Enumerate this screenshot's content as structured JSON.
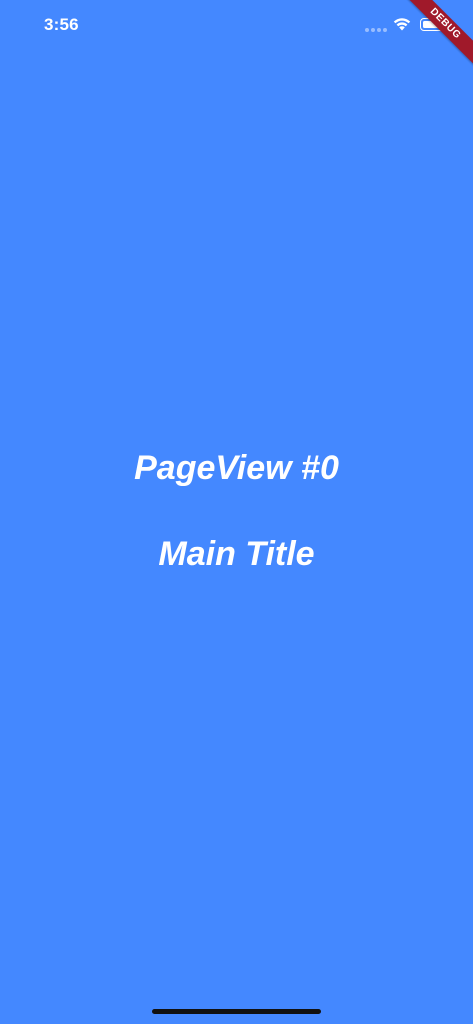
{
  "status_bar": {
    "time": "3:56",
    "wifi_icon": "wifi-icon",
    "battery_icon": "battery-icon"
  },
  "debug_banner": {
    "label": "DEBUG",
    "color": "#a0192a"
  },
  "page": {
    "label": "PageView #0",
    "title": "Main Title",
    "background": "#4488ff"
  }
}
